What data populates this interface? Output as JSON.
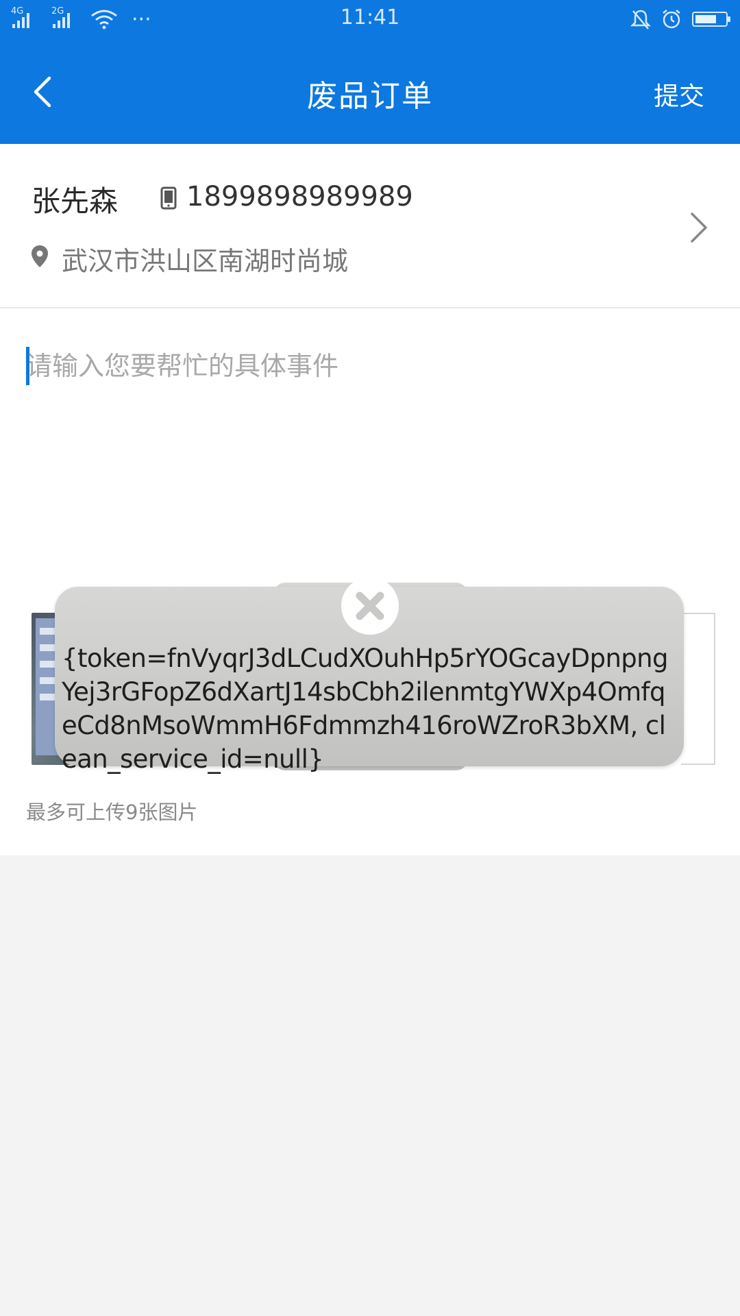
{
  "status_bar": {
    "time": "11:41",
    "network_1": "4G",
    "network_2": "2G",
    "dots": "···"
  },
  "nav": {
    "title": "废品订单",
    "submit_label": "提交"
  },
  "contact": {
    "name": "张先森",
    "phone": "1899898989989",
    "address": "武汉市洪山区南湖时尚城"
  },
  "editor": {
    "placeholder": "请输入您要帮忙的具体事件",
    "upload_hint": "最多可上传9张图片"
  },
  "toast": {
    "message": "{token=fnVyqrJ3dLCudXOuhHp5rYOGcayDpnpngYej3rGFopZ6dXartJ14sbCbh2ilenmtgYWXp4OmfqeCd8nMsoWmmH6Fdmmzh416roWZroR3bXM, clean_service_id=null}"
  },
  "colors": {
    "accent": "#0c78e0",
    "background": "#f3f3f3"
  }
}
